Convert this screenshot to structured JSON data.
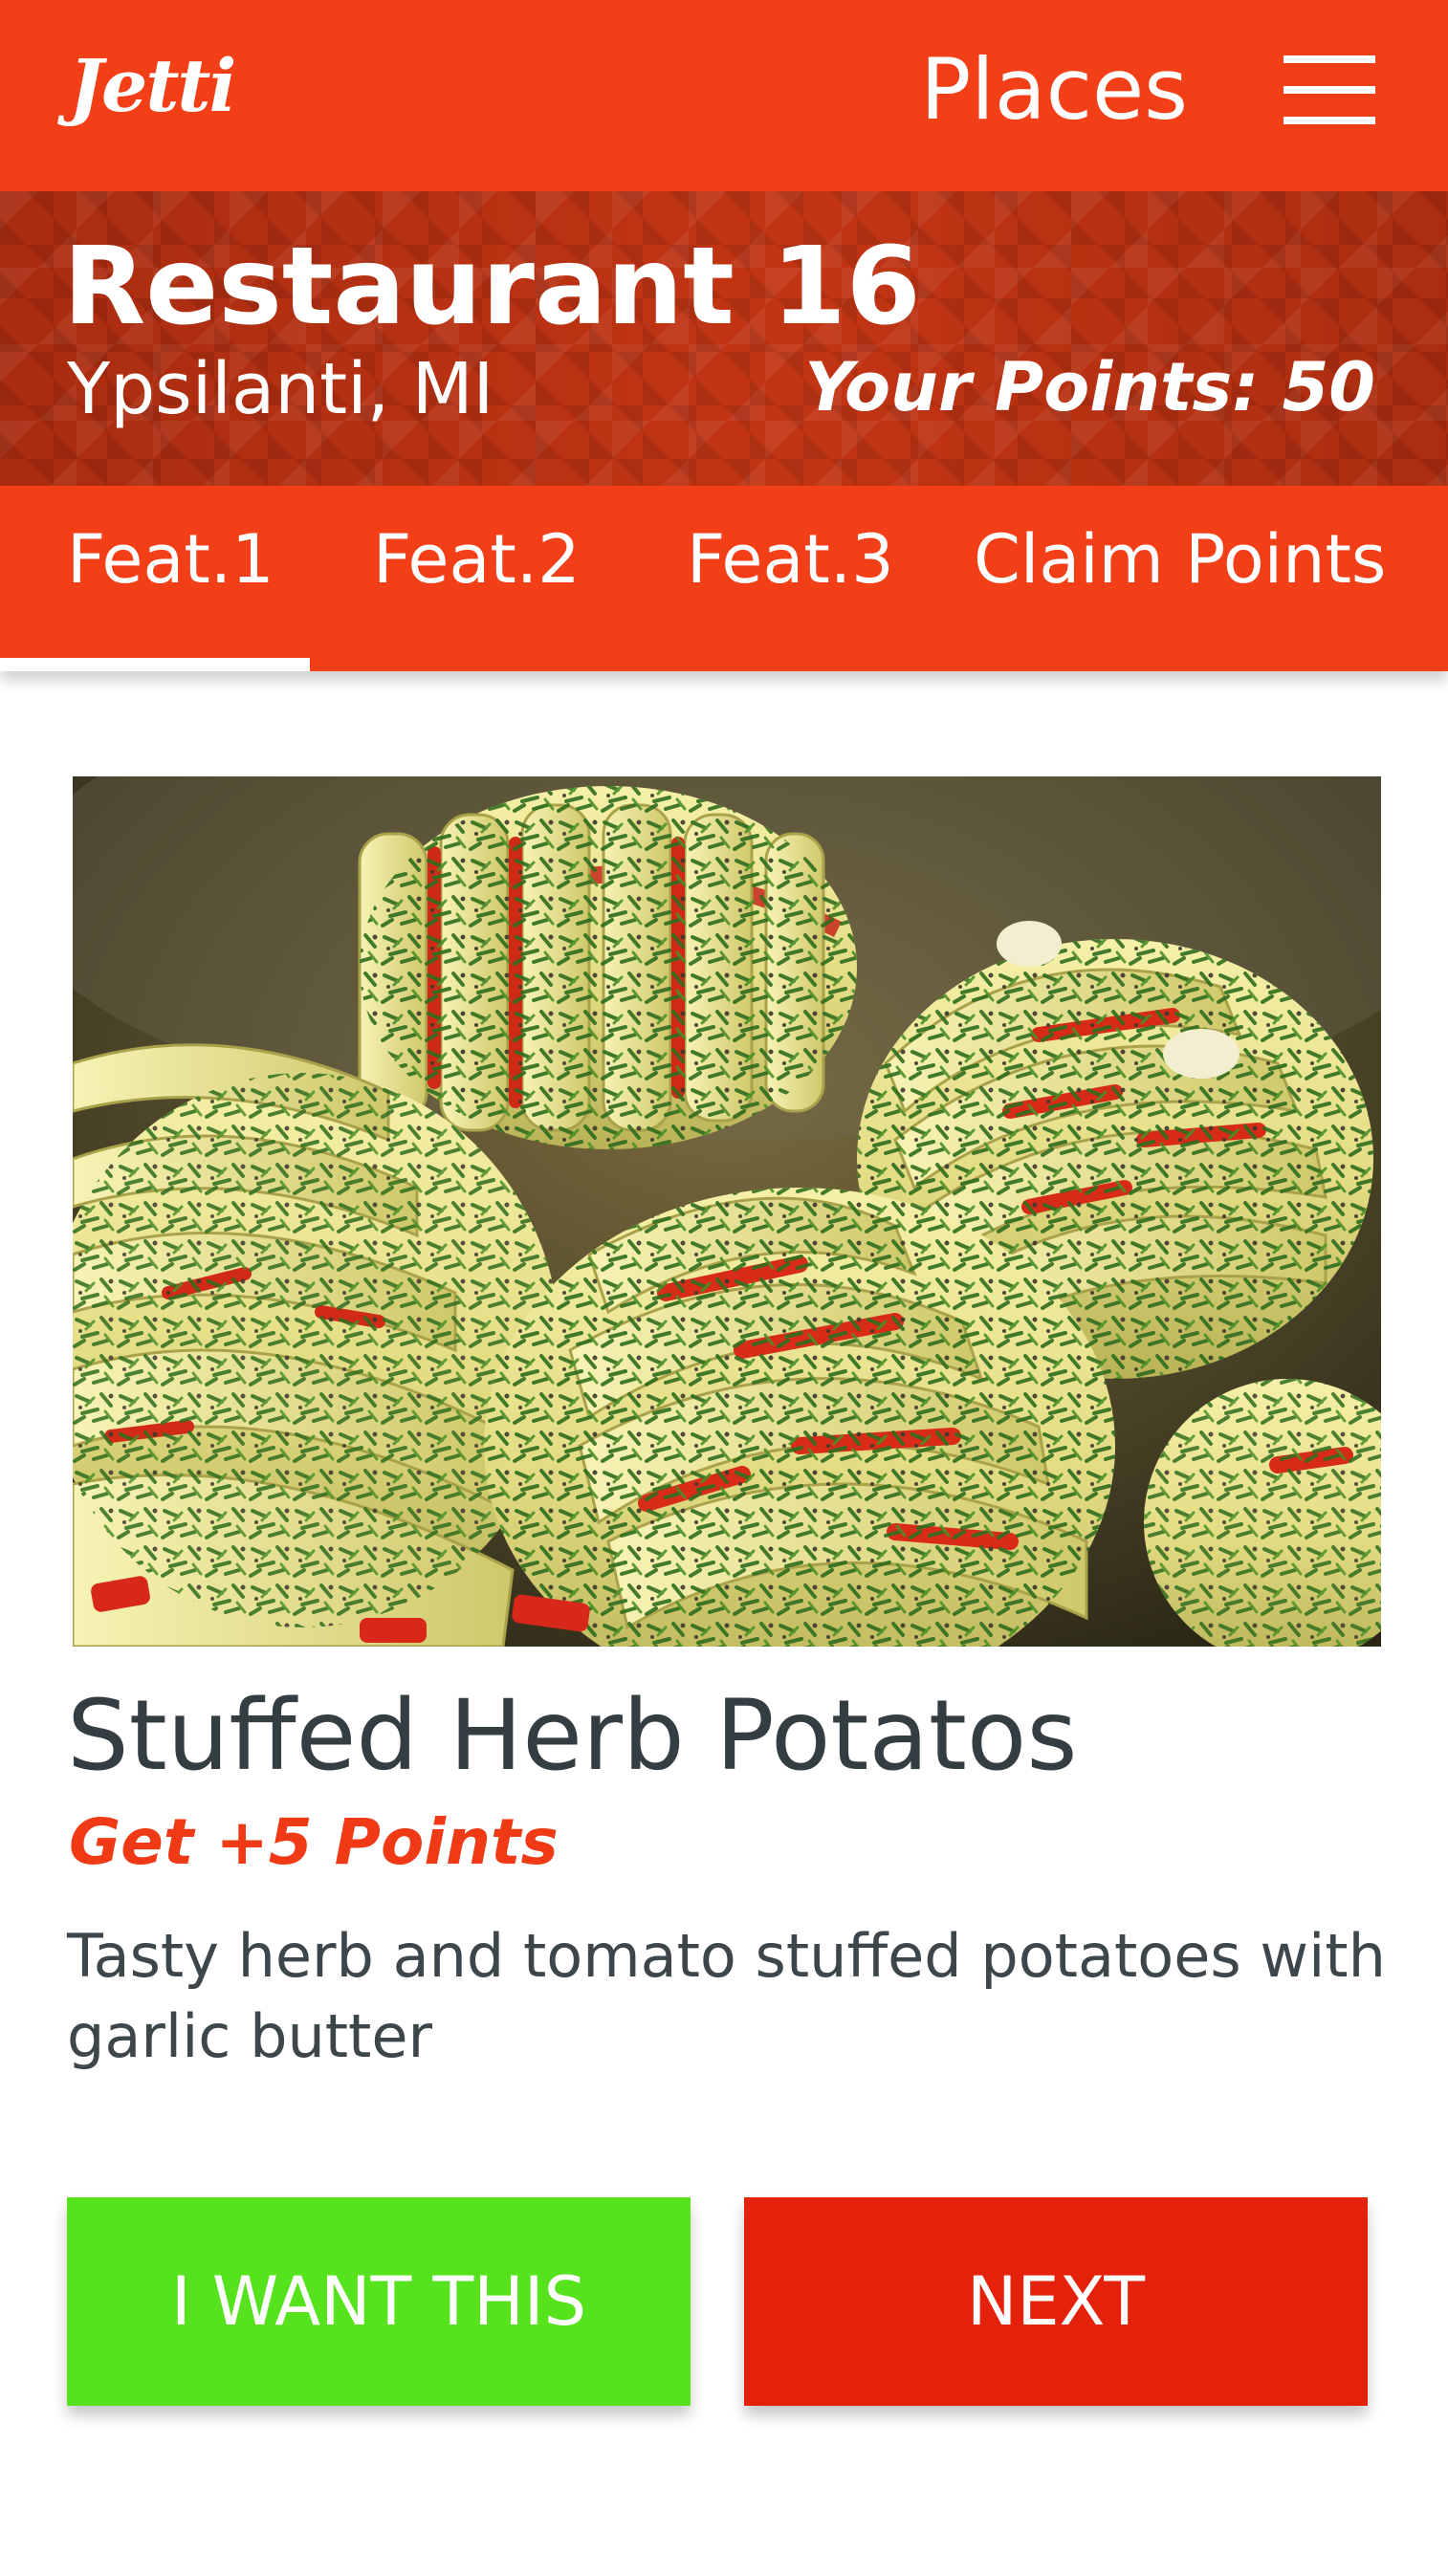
{
  "app_bar": {
    "logo_text": "Jetti",
    "places_label": "Places",
    "menu_icon": "hamburger-menu-icon"
  },
  "restaurant": {
    "name": "Restaurant 16",
    "location": "Ypsilanti, MI",
    "points_text": "Your Points: 50"
  },
  "tabs": [
    {
      "label": "Feat.1",
      "active": true
    },
    {
      "label": "Feat.2",
      "active": false
    },
    {
      "label": "Feat.3",
      "active": false
    },
    {
      "label": "Claim Points",
      "active": false
    }
  ],
  "feature": {
    "image_subject": "herb and red pepper stuffed hasselback potatoes",
    "title": "Stuffed Herb Potatos",
    "points_label": "Get +5 Points",
    "description": "Tasty herb and tomato stuffed potatoes with garlic butter"
  },
  "actions": {
    "want_label": "I WANT THIS",
    "next_label": "NEXT"
  },
  "colors": {
    "primary": "#f33f17",
    "header_dark": "#b12f12",
    "want_button": "#57e21e",
    "next_button": "#e4210a",
    "points_accent": "#f03a16",
    "title_text": "#333d42"
  }
}
